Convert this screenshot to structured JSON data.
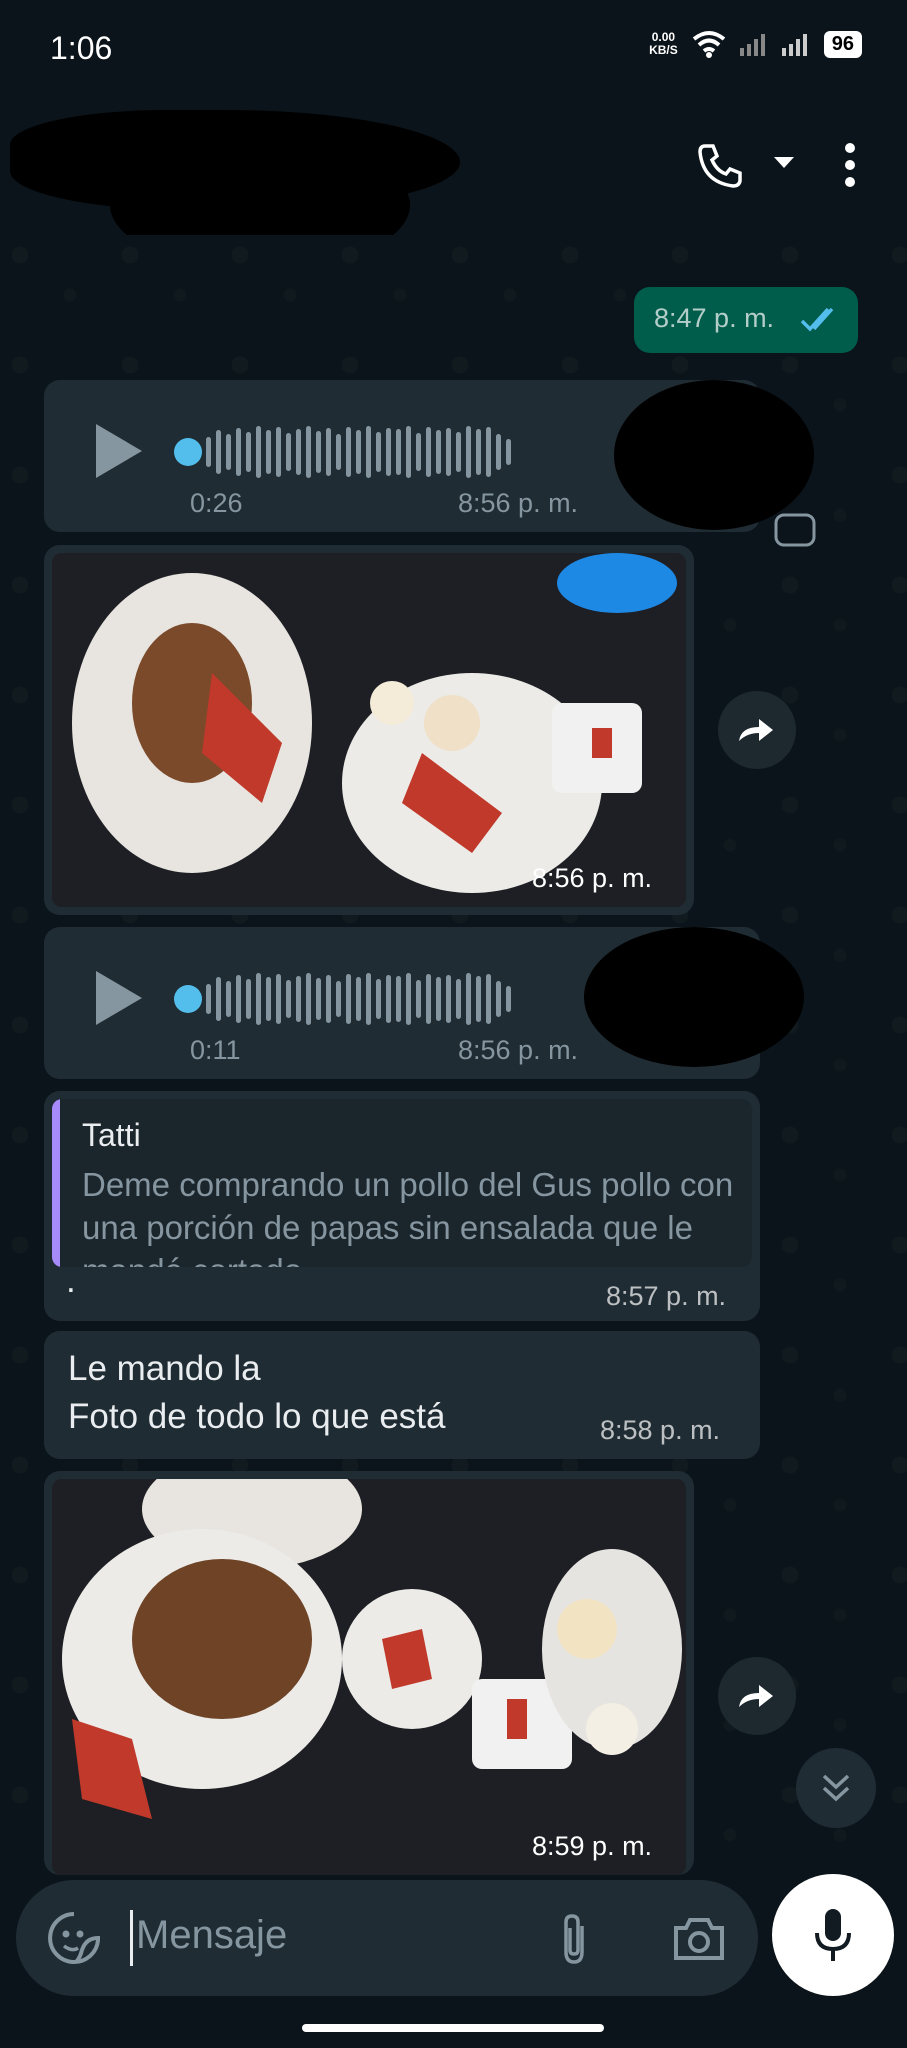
{
  "status_bar": {
    "time": "1:06",
    "net_speed_value": "0.00",
    "net_speed_unit": "KB/S",
    "battery": "96"
  },
  "header": {
    "icons": [
      "back-arrow-icon",
      "phone-icon",
      "dropdown-arrow-icon",
      "more-vert-icon"
    ]
  },
  "messages": [
    {
      "type": "outgoing-text",
      "time": "8:47 p. m."
    },
    {
      "type": "voice",
      "duration": "0:26",
      "time": "8:56 p. m."
    },
    {
      "type": "image",
      "time": "8:56 p. m."
    },
    {
      "type": "voice",
      "duration": "0:11",
      "time": "8:56 p. m."
    },
    {
      "type": "reply",
      "quote_author": "Tatti",
      "quote_text": "Deme comprando un pollo del Gus pollo con una porción de papas sin ensalada que le mandé cortado...",
      "body": ".",
      "time": "8:57 p. m."
    },
    {
      "type": "text",
      "body_line1": "Le mando la",
      "body_line2": "Foto de todo lo que está",
      "time": "8:58 p. m."
    },
    {
      "type": "image",
      "time": "8:59 p. m."
    }
  ],
  "composer": {
    "placeholder": "Mensaje"
  },
  "colors": {
    "background": "#0b141a",
    "bubble_in": "#202c33",
    "bubble_out": "#005c4b",
    "read_ticks": "#53bdeb",
    "quote_bar": "#a78bfa"
  }
}
